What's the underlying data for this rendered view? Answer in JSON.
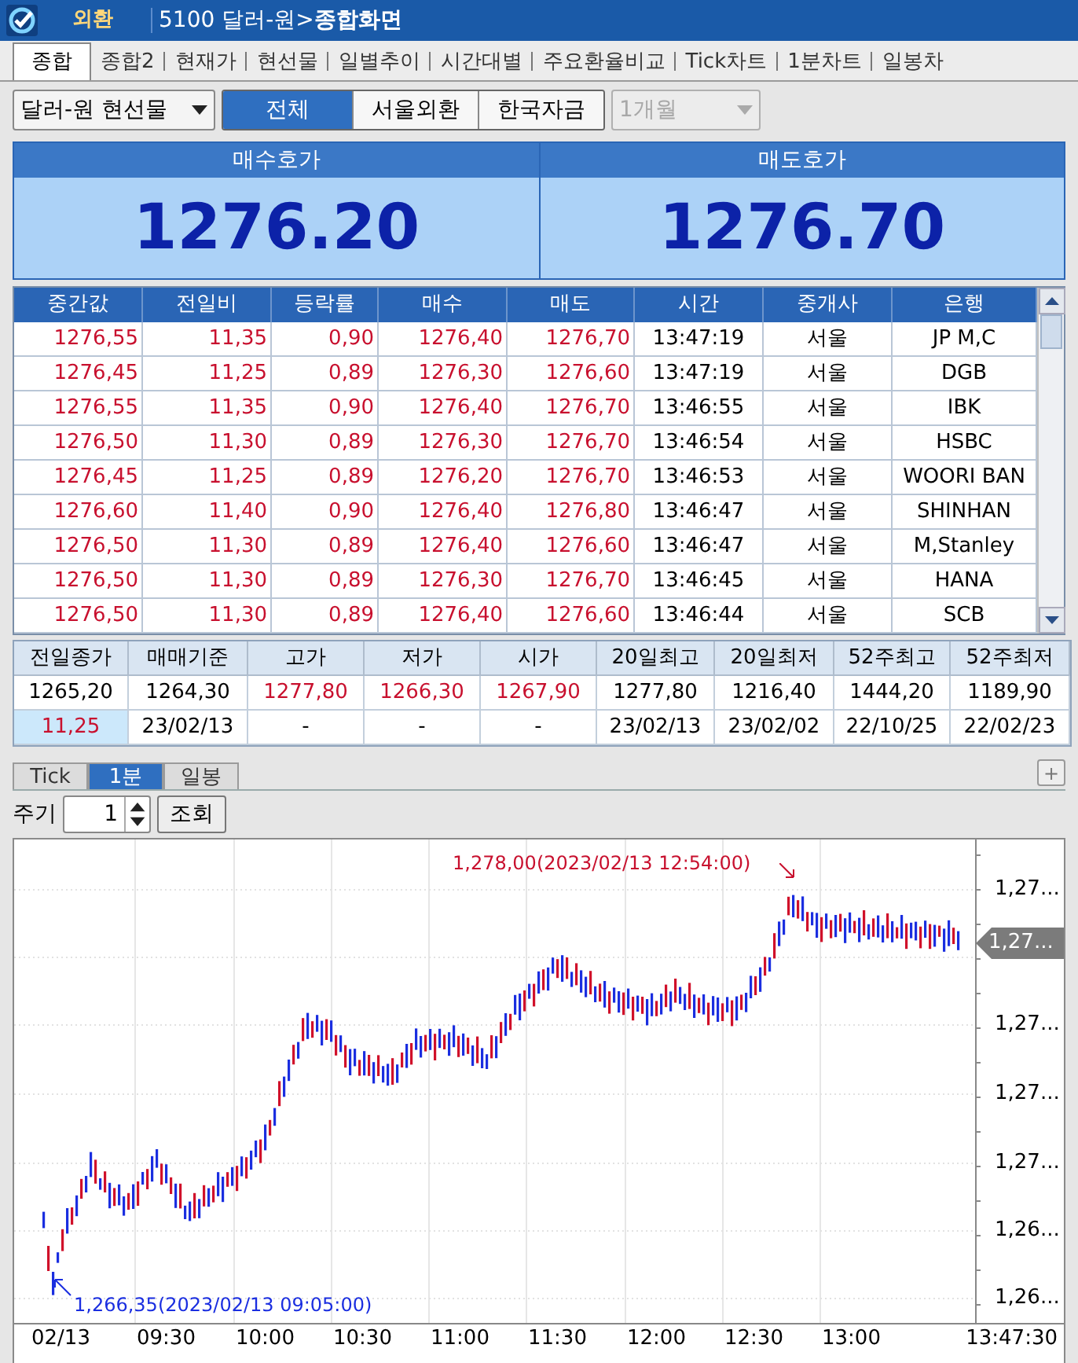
{
  "title_bar": {
    "badge": "외환",
    "path": "5100 달러-원>**종합화면**"
  },
  "tabs": [
    {
      "label": "종합",
      "selected": true
    },
    {
      "label": "종합2",
      "selected": false
    },
    {
      "label": "현재가",
      "selected": false
    },
    {
      "label": "현선물",
      "selected": false
    },
    {
      "label": "일별추이",
      "selected": false
    },
    {
      "label": "시간대별",
      "selected": false
    },
    {
      "label": "주요환율비교",
      "selected": false
    },
    {
      "label": "Tick차트",
      "selected": false
    },
    {
      "label": "1분차트",
      "selected": false
    },
    {
      "label": "일봉차",
      "selected": false
    }
  ],
  "toolbar": {
    "product_select": "달러-원 현선물",
    "segments": [
      {
        "label": "전체",
        "selected": true
      },
      {
        "label": "서울외환",
        "selected": false
      },
      {
        "label": "한국자금",
        "selected": false
      }
    ],
    "period_select": {
      "value": "1개월",
      "disabled": true
    }
  },
  "quotes": [
    {
      "label": "매수호가",
      "value": "1276.20"
    },
    {
      "label": "매도호가",
      "value": "1276.70"
    }
  ],
  "trades": {
    "columns": [
      {
        "label": "중간값",
        "up": true
      },
      {
        "label": "전일비",
        "up": true
      },
      {
        "label": "등락률",
        "up": true
      },
      {
        "label": "매수",
        "up": true
      },
      {
        "label": "매도",
        "up": true
      },
      {
        "label": "시간",
        "up": false
      },
      {
        "label": "중개사",
        "up": false
      },
      {
        "label": "은행",
        "up": false
      }
    ],
    "rows": [
      [
        "1276,55",
        "11,35",
        "0,90",
        "1276,40",
        "1276,70",
        "13:47:19",
        "서울",
        "JP M,C"
      ],
      [
        "1276,45",
        "11,25",
        "0,89",
        "1276,30",
        "1276,60",
        "13:47:19",
        "서울",
        "DGB"
      ],
      [
        "1276,55",
        "11,35",
        "0,90",
        "1276,40",
        "1276,70",
        "13:46:55",
        "서울",
        "IBK"
      ],
      [
        "1276,50",
        "11,30",
        "0,89",
        "1276,30",
        "1276,70",
        "13:46:54",
        "서울",
        "HSBC"
      ],
      [
        "1276,45",
        "11,25",
        "0,89",
        "1276,20",
        "1276,70",
        "13:46:53",
        "서울",
        "WOORI BAN"
      ],
      [
        "1276,60",
        "11,40",
        "0,90",
        "1276,40",
        "1276,80",
        "13:46:47",
        "서울",
        "SHINHAN"
      ],
      [
        "1276,50",
        "11,30",
        "0,89",
        "1276,40",
        "1276,60",
        "13:46:47",
        "서울",
        "M,Stanley"
      ],
      [
        "1276,50",
        "11,30",
        "0,89",
        "1276,30",
        "1276,70",
        "13:46:45",
        "서울",
        "HANA"
      ],
      [
        "1276,50",
        "11,30",
        "0,89",
        "1276,40",
        "1276,60",
        "13:46:44",
        "서울",
        "SCB"
      ]
    ]
  },
  "summary": {
    "columns": [
      "전일종가",
      "매매기준",
      "고가",
      "저가",
      "시가",
      "20일최고",
      "20일최저",
      "52주최고",
      "52주최저"
    ],
    "rows": [
      [
        {
          "text": "1265,20",
          "up": false,
          "highlighted": false
        },
        {
          "text": "1264,30",
          "up": false,
          "highlighted": false
        },
        {
          "text": "1277,80",
          "up": true,
          "highlighted": false
        },
        {
          "text": "1266,30",
          "up": true,
          "highlighted": false
        },
        {
          "text": "1267,90",
          "up": true,
          "highlighted": false
        },
        {
          "text": "1277,80",
          "up": false,
          "highlighted": false
        },
        {
          "text": "1216,40",
          "up": false,
          "highlighted": false
        },
        {
          "text": "1444,20",
          "up": false,
          "highlighted": false
        },
        {
          "text": "1189,90",
          "up": false,
          "highlighted": false
        }
      ],
      [
        {
          "text": "11,25",
          "up": true,
          "highlighted": true
        },
        {
          "text": "23/02/13",
          "up": false,
          "highlighted": false
        },
        {
          "text": "-",
          "up": false,
          "highlighted": false
        },
        {
          "text": "-",
          "up": false,
          "highlighted": false
        },
        {
          "text": "-",
          "up": false,
          "highlighted": false
        },
        {
          "text": "23/02/13",
          "up": false,
          "highlighted": false
        },
        {
          "text": "23/02/02",
          "up": false,
          "highlighted": false
        },
        {
          "text": "22/10/25",
          "up": false,
          "highlighted": false
        },
        {
          "text": "22/02/23",
          "up": false,
          "highlighted": false
        }
      ]
    ]
  },
  "chart_tabs": [
    {
      "label": "Tick",
      "selected": false
    },
    {
      "label": "1분",
      "selected": true
    },
    {
      "label": "일봉",
      "selected": false
    }
  ],
  "expand_button": "+",
  "period": {
    "label": "주기",
    "value": "1",
    "button": "조회"
  },
  "chart": {
    "y_axis_labels": [
      "1,27...",
      "1,27...",
      "1,27...",
      "1,27...",
      "1,26...",
      "1,26..."
    ],
    "current_price": "1,27...",
    "x_axis_labels": [
      "02/13",
      "09:30",
      "10:00",
      "10:30",
      "11:00",
      "11:30",
      "12:00",
      "12:30",
      "13:00"
    ],
    "end_time": "13:47:30",
    "annotations": [
      {
        "kind": "high",
        "text": "1,278,00(2023/02/13 12:54:00)"
      },
      {
        "kind": "low",
        "text": "1,266,35(2023/02/13 09:05:00)"
      }
    ]
  }
}
